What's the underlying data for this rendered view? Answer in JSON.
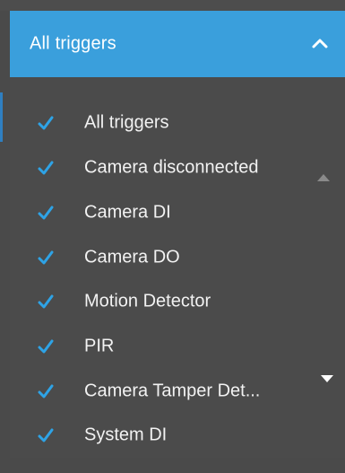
{
  "dropdown": {
    "selected_label": "All triggers",
    "items": [
      {
        "label": "All triggers",
        "checked": true
      },
      {
        "label": "Camera disconnected",
        "checked": true
      },
      {
        "label": "Camera DI",
        "checked": true
      },
      {
        "label": "Camera DO",
        "checked": true
      },
      {
        "label": "Motion Detector",
        "checked": true
      },
      {
        "label": "PIR",
        "checked": true
      },
      {
        "label": "Camera Tamper Det...",
        "checked": true
      },
      {
        "label": "System DI",
        "checked": true
      }
    ]
  },
  "icons": {
    "header": "chevron-up-icon",
    "check": "checkmark-icon",
    "scroll_up": "scroll-up-arrow-icon",
    "scroll_down": "scroll-down-arrow-icon"
  },
  "colors": {
    "header_background": "#3a9fdc",
    "panel_background": "#4b4b4b",
    "checkmark": "#2ea3e6",
    "text": "#f2f2f2",
    "scroll_up_arrow": "#8a8a8a",
    "scroll_down_arrow": "#ffffff"
  }
}
